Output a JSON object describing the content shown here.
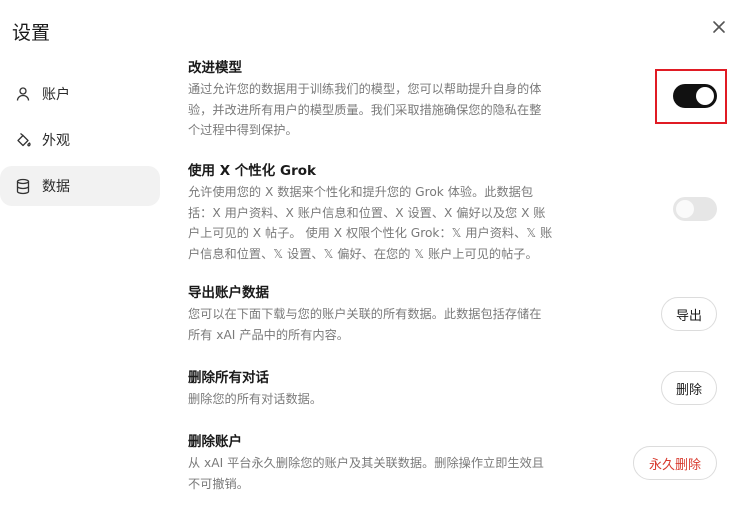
{
  "header": {
    "title": "设置"
  },
  "sidebar": {
    "items": [
      {
        "label": "账户",
        "icon": "user-icon"
      },
      {
        "label": "外观",
        "icon": "paint-bucket-icon"
      },
      {
        "label": "数据",
        "icon": "database-icon",
        "active": true
      }
    ]
  },
  "sections": {
    "improve_model": {
      "title": "改进模型",
      "desc_lines": [
        "通过允许您的数据用于训练我们的模型，您可以帮助提升自身的体",
        "验，并改进所有用户的模型质量。我们采取措施确保您的隐私在整",
        "个过程中得到保护。"
      ],
      "enabled": true
    },
    "personalize": {
      "title": "使用 X 个性化 Grok",
      "desc_lines": [
        "允许使用您的 X 数据来个性化和提升您的 Grok 体验。此数据包",
        "括：X 用户资料、X 账户信息和位置、X 设置、X 偏好以及您 X 账",
        "户上可见的 X 帖子。 使用 X 权限个性化 Grok：𝕏 用户资料、𝕏 账",
        "户信息和位置、𝕏 设置、𝕏 偏好、在您的 𝕏 账户上可见的帖子。"
      ],
      "enabled": false
    },
    "export": {
      "title": "导出账户数据",
      "desc_lines": [
        "您可以在下面下载与您的账户关联的所有数据。此数据包括存储在",
        "所有 xAI 产品中的所有内容。"
      ],
      "button_label": "导出"
    },
    "delete_chats": {
      "title": "删除所有对话",
      "desc_lines": [
        "删除您的所有对话数据。"
      ],
      "button_label": "删除"
    },
    "delete_account": {
      "title": "删除账户",
      "desc_lines": [
        "从 xAI 平台永久删除您的账户及其关联数据。删除操作立即生效且",
        "不可撤销。"
      ],
      "button_label": "永久删除"
    }
  },
  "colors": {
    "accent": "#111111",
    "danger": "#d83a2e",
    "highlight": "#e01b24",
    "muted": "#7a7a7a"
  }
}
